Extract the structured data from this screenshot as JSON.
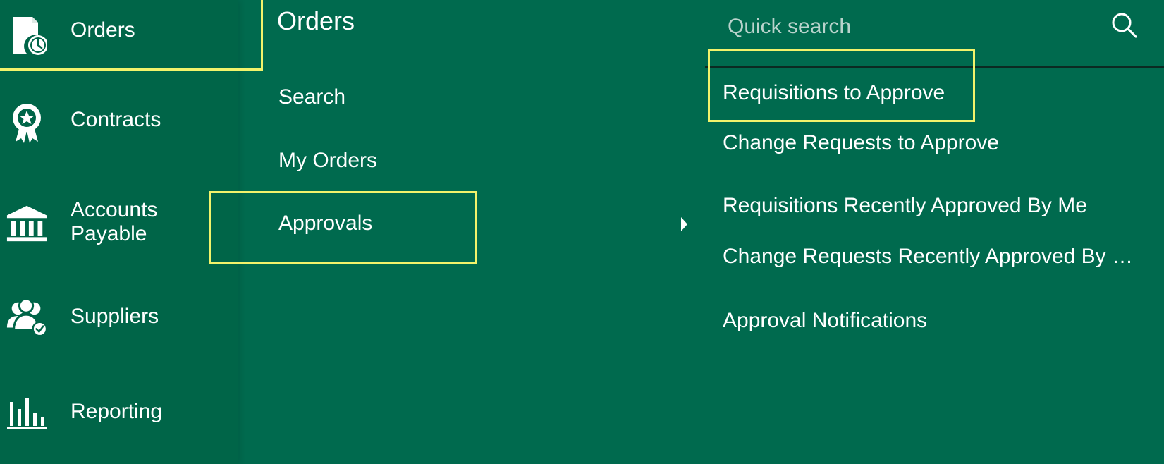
{
  "nav": {
    "items": [
      {
        "label": "Orders",
        "icon": "orders-icon"
      },
      {
        "label": "Contracts",
        "icon": "contracts-icon"
      },
      {
        "label": "Accounts\nPayable",
        "icon": "bank-icon"
      },
      {
        "label": "Suppliers",
        "icon": "suppliers-icon"
      },
      {
        "label": "Reporting",
        "icon": "bar-chart-icon"
      }
    ]
  },
  "submenu": {
    "title": "Orders",
    "items": [
      {
        "label": "Search"
      },
      {
        "label": "My Orders"
      },
      {
        "label": "Approvals"
      }
    ]
  },
  "search": {
    "placeholder": "Quick search",
    "value": ""
  },
  "approvals": {
    "items": [
      {
        "label": "Requisitions to Approve"
      },
      {
        "label": "Change Requests to Approve"
      },
      {
        "label": "Requisitions Recently Approved By Me"
      },
      {
        "label": "Change Requests Recently Approved By …"
      },
      {
        "label": "Approval Notifications"
      }
    ]
  },
  "colors": {
    "background": "#006a4e",
    "nav_background": "#006548",
    "highlight": "#f2f36b",
    "text": "#ffffff",
    "placeholder": "#b9d3cc"
  }
}
